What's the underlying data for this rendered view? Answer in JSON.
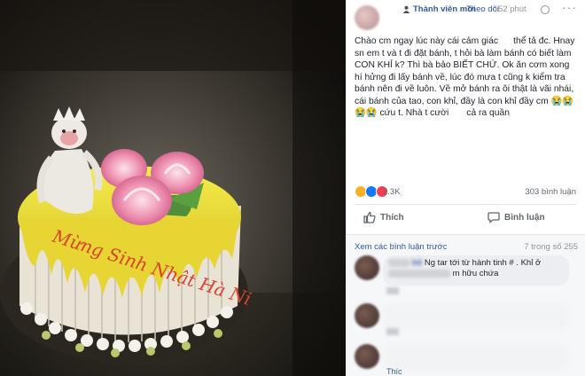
{
  "header": {
    "member_label": "Thành viên mới",
    "follow_label": "Theo dõi",
    "time": "52 phút",
    "more": "···"
  },
  "post": {
    "text": "Chào cm ngay lúc này cái cảm giác      thể tả đc. Hnay sn em t và t đi đặt bánh, t hỏi bà làm bánh có biết làm CON KHỈ k? Thì bà bảo BIẾT CHỨ. Ok ăn cơm xong hí hửng đi lấy bánh về, lúc đó mưa t cũng k kiểm tra bánh nên đi về luôn. Về mở bánh ra ôi thật là vãi nhái, cái bánh của tao, con khỉ, đầy là con khỉ đầy cm 😭😭😭😭 cứu t. Nhà t cười       cả ra quần"
  },
  "reactions": {
    "count": "2.3K",
    "comments": "303 bình luận",
    "colors": {
      "haha": "#f7b125",
      "like": "#1877f2",
      "love": "#f33e58"
    }
  },
  "actions": {
    "like_label": "Thích",
    "comment_label": "Bình luận"
  },
  "comments": {
    "view_previous": "Xem các bình luận trước",
    "page_info": "7 trong số 255",
    "items": [
      {
        "name": "hồ",
        "text": "Ng tar tới từ hành tinh # . Khỉ ở",
        "text2": "m hữu chứa"
      },
      {
        "name": "",
        "text": ""
      },
      {
        "name": "",
        "text": ""
      }
    ],
    "reply_label": "Thíc"
  },
  "photo": {
    "cake_text": "Mừng Sinh Nhật Hà Ni"
  }
}
